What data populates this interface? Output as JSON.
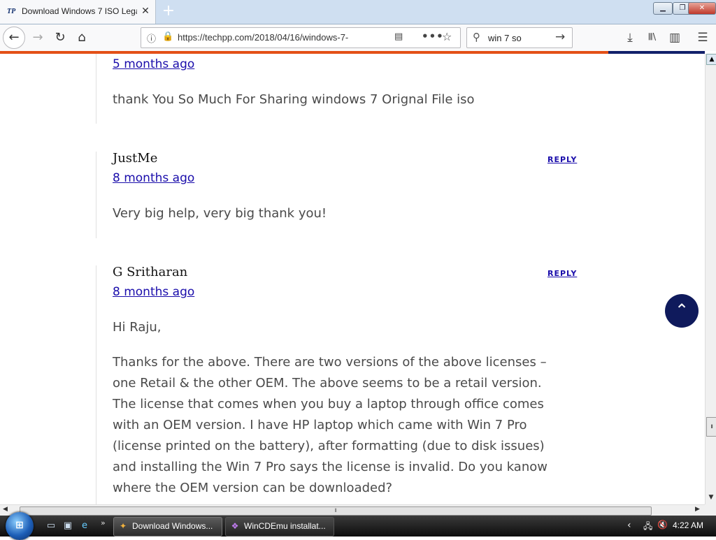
{
  "browser": {
    "tab_icon": "TP",
    "tab_title": "Download Windows 7 ISO Lega",
    "tab_close": "✕",
    "new_tab": "+",
    "window_buttons": {
      "minimize": "▁",
      "restore": "❐",
      "close": "✕"
    },
    "url": "https://techpp.com/2018/04/16/windows-7-",
    "search_value": "win 7 so",
    "icons": {
      "back": "←",
      "forward": "→",
      "reload": "↻",
      "home": "⌂",
      "info": "ⓘ",
      "lock": "🔒",
      "reader": "▤",
      "more": "•••",
      "star": "☆",
      "search": "⚲",
      "search_go": "→",
      "download": "⤓",
      "library": "𝄃𝄃\\",
      "sidebar": "▥",
      "menu": "☰"
    }
  },
  "page": {
    "comments": [
      {
        "author": "",
        "date": "5 months ago",
        "reply": "",
        "text": "thank You So Much For Sharing windows 7 Orignal File iso"
      },
      {
        "author": "JustMe",
        "date": "8 months ago",
        "reply": "REPLY",
        "text": "Very big help, very big thank you!"
      },
      {
        "author": "G Sritharan",
        "date": "8 months ago",
        "reply": "REPLY",
        "greeting": "Hi Raju,",
        "text": "Thanks for the above. There are two versions of the above licenses – one Retail & the other OEM. The above seems to be a retail version. The license that comes when you buy a laptop through office comes with an OEM version. I have HP laptop which came with Win 7 Pro (license printed on the battery), after formatting (due to disk issues) and installing the Win 7 Pro says the license is invalid. Do you kanow where the OEM version can be downloaded?"
      }
    ],
    "scroll_top_icon": "⌃"
  },
  "scrollbars": {
    "up": "▲",
    "down": "▼",
    "left": "◀",
    "right": "▶",
    "grip": "⦀"
  },
  "taskbar": {
    "start_logo": "⊞",
    "chevron": "»",
    "tasks": [
      {
        "label": "Download Windows...",
        "icon": "✦",
        "active": true
      },
      {
        "label": "WinCDEmu installat...",
        "icon": "❖",
        "active": false
      }
    ],
    "tray_icons": {
      "arrow": "‹",
      "network": "🖧",
      "volume": "🔇"
    },
    "clock": "4:22 AM"
  },
  "colors": {
    "accent_orange": "#e35017",
    "accent_navy": "#12206a",
    "link": "#1a0dab"
  }
}
